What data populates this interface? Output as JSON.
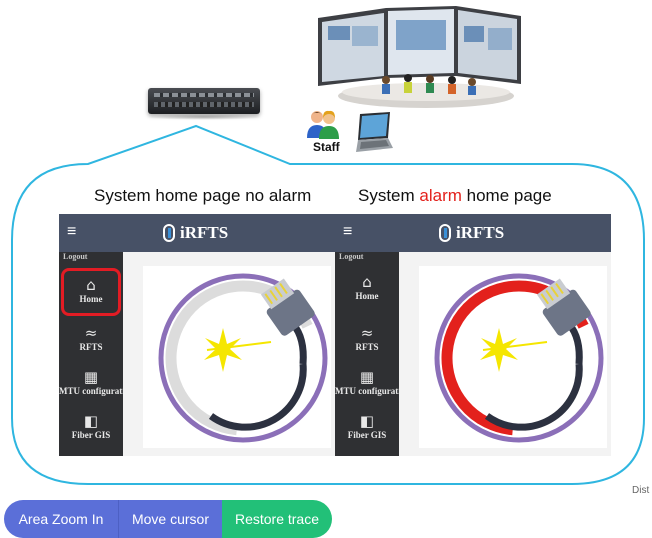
{
  "illustration": {
    "staff_label": "Staff"
  },
  "panels": [
    {
      "title": "System home page no alarm",
      "brand": "iRFTS",
      "menu_icon": "≡",
      "logout": "Logout",
      "sidebar": [
        {
          "label": "Home",
          "icon": "home-icon"
        },
        {
          "label": "RFTS",
          "icon": "trace-icon"
        },
        {
          "label": "MTU configurati",
          "icon": "grid-icon"
        },
        {
          "label": "Fiber GIS",
          "icon": "map-icon"
        }
      ],
      "ring_state": "normal"
    },
    {
      "title_before": "System ",
      "title_alarm": "alarm",
      "title_after": " home page",
      "brand": "iRFTS",
      "menu_icon": "≡",
      "logout": "Logout",
      "sidebar": [
        {
          "label": "Home",
          "icon": "home-icon"
        },
        {
          "label": "RFTS",
          "icon": "trace-icon"
        },
        {
          "label": "MTU configurati",
          "icon": "grid-icon"
        },
        {
          "label": "Fiber GIS",
          "icon": "map-icon"
        }
      ],
      "ring_state": "alarm"
    }
  ],
  "colors": {
    "bubble_outline": "#2fb6e0",
    "alarm_red": "#e3211c",
    "ring_purple": "#8b6fb8",
    "header": "#475166",
    "sidebar": "#2f3033"
  },
  "toolbar": {
    "zoom_label": "Area Zoom In",
    "move_label": "Move cursor",
    "restore_label": "Restore trace"
  },
  "corner_text": "Dist"
}
